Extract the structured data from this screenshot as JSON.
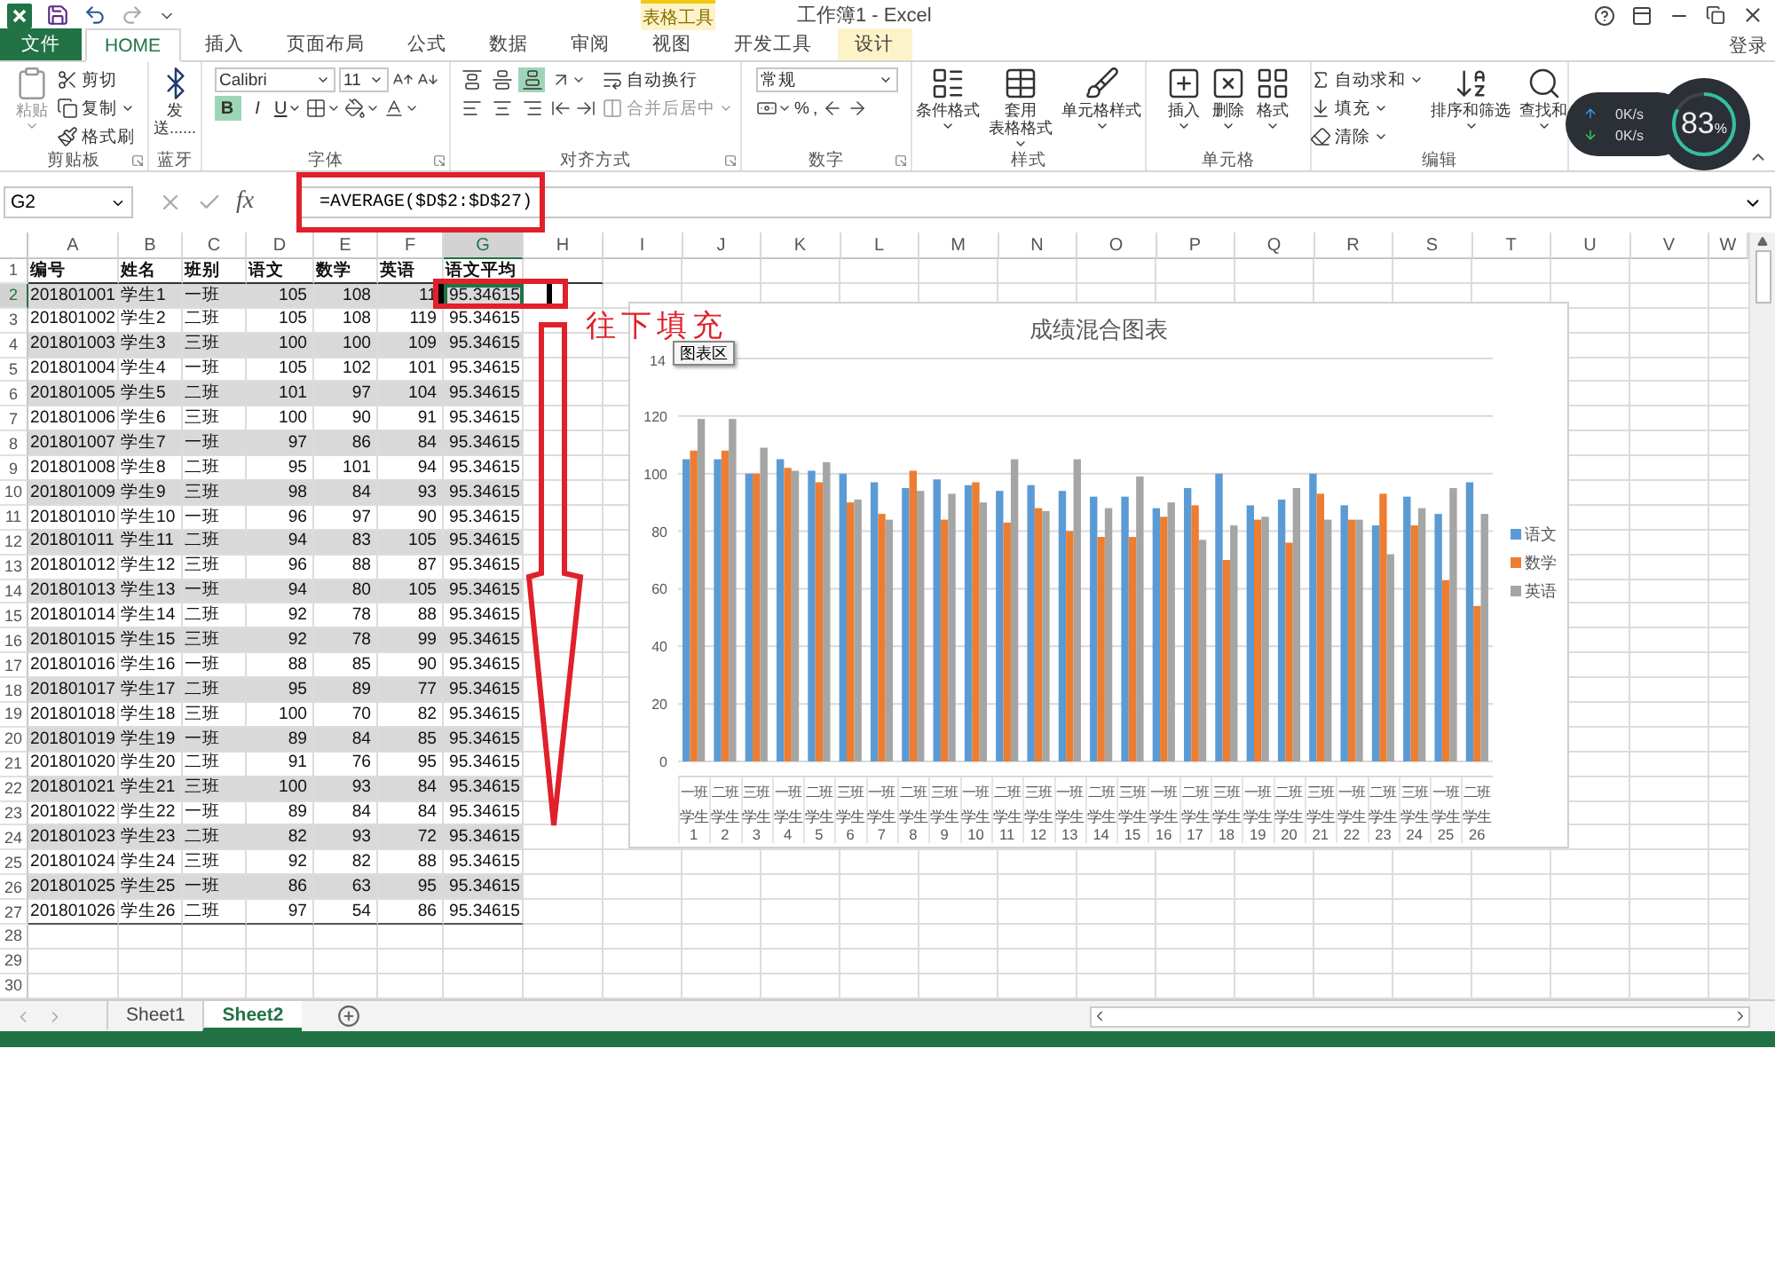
{
  "window": {
    "title": "工作簿1 - Excel",
    "contextual_label": "表格工具",
    "sign_in": "登录"
  },
  "ribbon": {
    "tabs": [
      {
        "label": "文件",
        "kind": "file",
        "selected": false
      },
      {
        "label": "HOME",
        "kind": "normal",
        "selected": true
      },
      {
        "label": "插入",
        "kind": "normal",
        "selected": false
      },
      {
        "label": "页面布局",
        "kind": "normal",
        "selected": false
      },
      {
        "label": "公式",
        "kind": "normal",
        "selected": false
      },
      {
        "label": "数据",
        "kind": "normal",
        "selected": false
      },
      {
        "label": "审阅",
        "kind": "normal",
        "selected": false
      },
      {
        "label": "视图",
        "kind": "normal",
        "selected": false
      },
      {
        "label": "开发工具",
        "kind": "normal",
        "selected": false
      },
      {
        "label": "设计",
        "kind": "contextual",
        "selected": false
      }
    ],
    "groups": [
      {
        "label": "剪贴板",
        "launcher": true,
        "blocks": [
          {
            "kind": "large",
            "label": "粘贴",
            "menu": true,
            "disabled": true
          },
          {
            "kind": "stack",
            "lines": [
              [
                {
                  "kind": "button",
                  "label": "剪切"
                }
              ],
              [
                {
                  "kind": "button",
                  "label": "复制",
                  "menu": true
                }
              ],
              [
                {
                  "kind": "button",
                  "label": "格式刷"
                }
              ]
            ]
          }
        ]
      },
      {
        "label": "蓝牙",
        "blocks": [
          {
            "kind": "large",
            "lines": [
              "发",
              "送......"
            ]
          }
        ]
      },
      {
        "label": "字体",
        "launcher": true,
        "blocks": [
          {
            "kind": "stack",
            "lines": [
              [
                {
                  "kind": "field",
                  "value": "Calibri"
                },
                {
                  "kind": "field",
                  "value": "11"
                },
                {
                  "kind": "icon"
                },
                {
                  "kind": "icon"
                }
              ],
              [
                {
                  "kind": "toggle",
                  "label": "B",
                  "pressed": true
                },
                {
                  "kind": "toggle",
                  "label": "I",
                  "pressed": false
                },
                {
                  "kind": "toggle",
                  "label": "U",
                  "pressed": false,
                  "menu": true
                },
                {
                  "kind": "icon",
                  "menu": true
                },
                {
                  "kind": "icon",
                  "menu": true
                },
                {
                  "kind": "icon",
                  "menu": true
                }
              ]
            ]
          }
        ]
      },
      {
        "label": "对齐方式",
        "launcher": true,
        "blocks": [
          {
            "kind": "stack",
            "lines": [
              [
                {
                  "kind": "toggle",
                  "pressed": false
                },
                {
                  "kind": "toggle",
                  "pressed": false
                },
                {
                  "kind": "toggle",
                  "pressed": true
                }
              ],
              [
                {
                  "kind": "toggle",
                  "pressed": false
                },
                {
                  "kind": "toggle",
                  "pressed": false
                },
                {
                  "kind": "toggle",
                  "pressed": false
                }
              ]
            ]
          },
          {
            "kind": "stack",
            "lines": [
              [
                {
                  "kind": "icon",
                  "menu": true
                }
              ],
              [
                {
                  "kind": "icon"
                },
                {
                  "kind": "icon"
                }
              ]
            ]
          },
          {
            "kind": "stack",
            "lines": [
              [
                {
                  "kind": "button",
                  "label": "自动换行"
                }
              ],
              [
                {
                  "kind": "button",
                  "label": "合并后居中",
                  "menu": true,
                  "disabled": true
                }
              ]
            ]
          }
        ]
      },
      {
        "label": "数字",
        "launcher": true,
        "blocks": [
          {
            "kind": "stack",
            "lines": [
              [
                {
                  "kind": "field",
                  "value": "常规"
                }
              ],
              [
                {
                  "kind": "icon",
                  "menu": true
                },
                {
                  "kind": "button",
                  "label": "%"
                },
                {
                  "kind": "button",
                  "label": ","
                },
                {
                  "kind": "icon"
                },
                {
                  "kind": "icon"
                }
              ]
            ]
          }
        ]
      },
      {
        "label": "样式",
        "blocks": [
          {
            "kind": "large",
            "label": "条件格式",
            "menu": true
          },
          {
            "kind": "large",
            "lines": [
              "套用",
              "表格格式"
            ],
            "menu": true
          },
          {
            "kind": "large",
            "label": "单元格样式",
            "menu": true
          }
        ]
      },
      {
        "label": "单元格",
        "blocks": [
          {
            "kind": "large",
            "label": "插入",
            "menu": true
          },
          {
            "kind": "large",
            "label": "删除",
            "menu": true
          },
          {
            "kind": "large",
            "label": "格式",
            "menu": true
          }
        ]
      },
      {
        "label": "编辑",
        "blocks": [
          {
            "kind": "stack",
            "lines": [
              [
                {
                  "kind": "button",
                  "label": "自动求和",
                  "menu": true
                }
              ],
              [
                {
                  "kind": "button",
                  "label": "填充",
                  "menu": true
                }
              ],
              [
                {
                  "kind": "button",
                  "label": "清除",
                  "menu": true
                }
              ]
            ]
          },
          {
            "kind": "large",
            "label": "排序和筛选",
            "menu": true
          },
          {
            "kind": "large",
            "label": "查找和",
            "menu": true
          }
        ]
      }
    ]
  },
  "net_widget": {
    "upload": "0K/s",
    "download": "0K/s",
    "usage": "83$_{%}$",
    "level": 0.83
  },
  "formula_bar": {
    "name_box": "G2",
    "fx": "fx",
    "formula": "=AVERAGE($D$2:$D$27)"
  },
  "sheet": {
    "columns": [
      {
        "label": "A",
        "selected": false
      },
      {
        "label": "B",
        "selected": false
      },
      {
        "label": "C",
        "selected": false
      },
      {
        "label": "D",
        "selected": false
      },
      {
        "label": "E",
        "selected": false
      },
      {
        "label": "F",
        "selected": false
      },
      {
        "label": "G",
        "selected": true
      },
      {
        "label": "H",
        "selected": false
      },
      {
        "label": "I",
        "selected": false
      },
      {
        "label": "J",
        "selected": false
      },
      {
        "label": "K",
        "selected": false
      },
      {
        "label": "L",
        "selected": false
      },
      {
        "label": "M",
        "selected": false
      },
      {
        "label": "N",
        "selected": false
      },
      {
        "label": "O",
        "selected": false
      },
      {
        "label": "P",
        "selected": false
      },
      {
        "label": "Q",
        "selected": false
      },
      {
        "label": "R",
        "selected": false
      },
      {
        "label": "S",
        "selected": false
      },
      {
        "label": "T",
        "selected": false
      },
      {
        "label": "U",
        "selected": false
      },
      {
        "label": "V",
        "selected": false
      },
      {
        "label": "W",
        "selected": false
      }
    ],
    "rows": [
      {
        "number": "1",
        "selected": false,
        "header": true,
        "cells": [
          "编号",
          "姓名",
          "班别",
          "语文",
          "数学",
          "英语",
          "语文平均"
        ]
      },
      {
        "number": "2",
        "selected": true,
        "cells": [
          "201801001",
          "学生1",
          "一班",
          "105",
          "108",
          "11",
          "95.34615"
        ]
      },
      {
        "number": "3",
        "selected": false,
        "cells": [
          "201801002",
          "学生2",
          "二班",
          "105",
          "108",
          "119",
          "95.34615"
        ]
      },
      {
        "number": "4",
        "selected": false,
        "cells": [
          "201801003",
          "学生3",
          "三班",
          "100",
          "100",
          "109",
          "95.34615"
        ]
      },
      {
        "number": "5",
        "selected": false,
        "cells": [
          "201801004",
          "学生4",
          "一班",
          "105",
          "102",
          "101",
          "95.34615"
        ]
      },
      {
        "number": "6",
        "selected": false,
        "cells": [
          "201801005",
          "学生5",
          "二班",
          "101",
          "97",
          "104",
          "95.34615"
        ]
      },
      {
        "number": "7",
        "selected": false,
        "cells": [
          "201801006",
          "学生6",
          "三班",
          "100",
          "90",
          "91",
          "95.34615"
        ]
      },
      {
        "number": "8",
        "selected": false,
        "cells": [
          "201801007",
          "学生7",
          "一班",
          "97",
          "86",
          "84",
          "95.34615"
        ]
      },
      {
        "number": "9",
        "selected": false,
        "cells": [
          "201801008",
          "学生8",
          "二班",
          "95",
          "101",
          "94",
          "95.34615"
        ]
      },
      {
        "number": "10",
        "selected": false,
        "cells": [
          "201801009",
          "学生9",
          "三班",
          "98",
          "84",
          "93",
          "95.34615"
        ]
      },
      {
        "number": "11",
        "selected": false,
        "cells": [
          "201801010",
          "学生10",
          "一班",
          "96",
          "97",
          "90",
          "95.34615"
        ]
      },
      {
        "number": "12",
        "selected": false,
        "cells": [
          "201801011",
          "学生11",
          "二班",
          "94",
          "83",
          "105",
          "95.34615"
        ]
      },
      {
        "number": "13",
        "selected": false,
        "cells": [
          "201801012",
          "学生12",
          "三班",
          "96",
          "88",
          "87",
          "95.34615"
        ]
      },
      {
        "number": "14",
        "selected": false,
        "cells": [
          "201801013",
          "学生13",
          "一班",
          "94",
          "80",
          "105",
          "95.34615"
        ]
      },
      {
        "number": "15",
        "selected": false,
        "cells": [
          "201801014",
          "学生14",
          "二班",
          "92",
          "78",
          "88",
          "95.34615"
        ]
      },
      {
        "number": "16",
        "selected": false,
        "cells": [
          "201801015",
          "学生15",
          "三班",
          "92",
          "78",
          "99",
          "95.34615"
        ]
      },
      {
        "number": "17",
        "selected": false,
        "cells": [
          "201801016",
          "学生16",
          "一班",
          "88",
          "85",
          "90",
          "95.34615"
        ]
      },
      {
        "number": "18",
        "selected": false,
        "cells": [
          "201801017",
          "学生17",
          "二班",
          "95",
          "89",
          "77",
          "95.34615"
        ]
      },
      {
        "number": "19",
        "selected": false,
        "cells": [
          "201801018",
          "学生18",
          "三班",
          "100",
          "70",
          "82",
          "95.34615"
        ]
      },
      {
        "number": "20",
        "selected": false,
        "cells": [
          "201801019",
          "学生19",
          "一班",
          "89",
          "84",
          "85",
          "95.34615"
        ]
      },
      {
        "number": "21",
        "selected": false,
        "cells": [
          "201801020",
          "学生20",
          "二班",
          "91",
          "76",
          "95",
          "95.34615"
        ]
      },
      {
        "number": "22",
        "selected": false,
        "cells": [
          "201801021",
          "学生21",
          "三班",
          "100",
          "93",
          "84",
          "95.34615"
        ]
      },
      {
        "number": "23",
        "selected": false,
        "cells": [
          "201801022",
          "学生22",
          "一班",
          "89",
          "84",
          "84",
          "95.34615"
        ]
      },
      {
        "number": "24",
        "selected": false,
        "cells": [
          "201801023",
          "学生23",
          "二班",
          "82",
          "93",
          "72",
          "95.34615"
        ]
      },
      {
        "number": "25",
        "selected": false,
        "cells": [
          "201801024",
          "学生24",
          "三班",
          "92",
          "82",
          "88",
          "95.34615"
        ]
      },
      {
        "number": "26",
        "selected": false,
        "cells": [
          "201801025",
          "学生25",
          "一班",
          "86",
          "63",
          "95",
          "95.34615"
        ]
      },
      {
        "number": "27",
        "selected": false,
        "cells": [
          "201801026",
          "学生26",
          "二班",
          "97",
          "54",
          "86",
          "95.34615"
        ]
      },
      {
        "number": "28",
        "selected": false
      },
      {
        "number": "29",
        "selected": false
      },
      {
        "number": "30",
        "selected": false
      }
    ]
  },
  "chart": {
    "tooltip": "图表区",
    "covered_tick": "14",
    "x_names": [
      "学生1",
      "学生2",
      "学生3",
      "学生4",
      "学生5",
      "学生6",
      "学生7",
      "学生8",
      "学生9",
      "学生10",
      "学生11",
      "学生12",
      "学生13",
      "学生14",
      "学生15",
      "学生16",
      "学生17",
      "学生18",
      "学生19",
      "学生20",
      "学生21",
      "学生22",
      "学生23",
      "学生24",
      "学生25",
      "学生26"
    ],
    "chart_data": {
      "type": "bar",
      "title": "成绩混合图表",
      "categories": [
        "一班",
        "二班",
        "三班",
        "一班",
        "二班",
        "三班",
        "一班",
        "二班",
        "三班",
        "一班",
        "二班",
        "三班",
        "一班",
        "二班",
        "三班",
        "一班",
        "二班",
        "三班",
        "一班",
        "二班",
        "三班",
        "一班",
        "二班",
        "三班",
        "一班",
        "二班"
      ],
      "series": [
        {
          "name": "语文",
          "color": "#5b9bd5",
          "values": [
            105,
            105,
            100,
            105,
            101,
            100,
            97,
            95,
            98,
            96,
            94,
            96,
            94,
            92,
            92,
            88,
            95,
            100,
            89,
            91,
            100,
            89,
            82,
            92,
            86,
            97
          ]
        },
        {
          "name": "数学",
          "color": "#ed7d31",
          "values": [
            108,
            108,
            100,
            102,
            97,
            90,
            86,
            101,
            84,
            97,
            83,
            88,
            80,
            78,
            78,
            85,
            89,
            70,
            84,
            76,
            93,
            84,
            93,
            82,
            63,
            54
          ]
        },
        {
          "name": "英语",
          "color": "#a5a5a5",
          "values": [
            119,
            119,
            109,
            101,
            104,
            91,
            84,
            94,
            93,
            90,
            105,
            87,
            105,
            88,
            99,
            90,
            77,
            82,
            85,
            95,
            84,
            84,
            72,
            88,
            95,
            86
          ]
        }
      ],
      "ylim": [
        0,
        140
      ],
      "yticks": [
        0,
        20,
        40,
        60,
        80,
        100,
        120
      ],
      "grid": true,
      "stacked": false,
      "legend": "right"
    }
  },
  "annotation": {
    "note": "往下填充"
  },
  "sheet_tabs": [
    {
      "label": "Sheet1",
      "selected": false
    },
    {
      "label": "Sheet2",
      "selected": true
    }
  ]
}
